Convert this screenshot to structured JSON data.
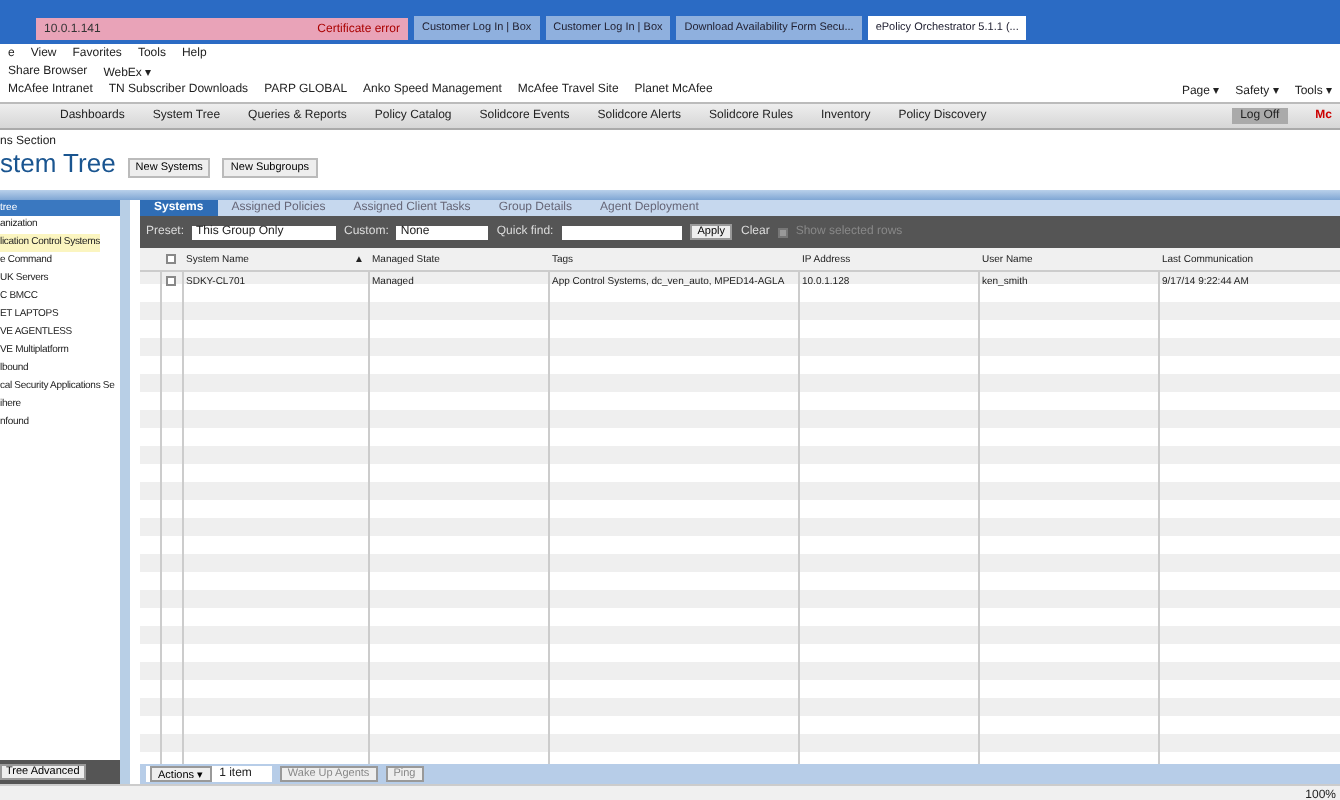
{
  "browser": {
    "address": "10.0.1.141",
    "certificate": "Certificate error",
    "tabs": [
      {
        "label": "Customer Log In | Box",
        "selected": false
      },
      {
        "label": "Customer Log In | Box",
        "selected": false
      },
      {
        "label": "Download Availability Form Secu...",
        "selected": false
      },
      {
        "label": "ePolicy Orchestrator 5.1.1 (...",
        "selected": true
      }
    ],
    "menu": [
      "e",
      "View",
      "Favorites",
      "Tools",
      "Help"
    ],
    "toolbar": [
      "Share Browser",
      "WebEx ▾"
    ],
    "favorites": [
      "McAfee Intranet",
      "TN Subscriber Downloads",
      "PARP GLOBAL",
      "Anko Speed Management",
      "McAfee Travel Site",
      "Planet McAfee"
    ],
    "commands": [
      "Page ▾",
      "Safety ▾",
      "Tools ▾"
    ]
  },
  "nav": {
    "items": [
      "Dashboards",
      "System Tree",
      "Queries & Reports",
      "Policy Catalog",
      "Solidcore Events",
      "Solidcore Alerts",
      "Solidcore Rules",
      "Inventory",
      "Policy Discovery"
    ],
    "log_off": "Log Off",
    "logo": "Mc"
  },
  "page": {
    "section": "ns Section",
    "title": "stem Tree",
    "buttons": [
      "New Systems",
      "New Subgroups"
    ]
  },
  "sidebar": {
    "header": "tree",
    "items": [
      {
        "label": "anization",
        "selected": false
      },
      {
        "label": "lication Control Systems",
        "selected": true
      },
      {
        "label": "e Command",
        "selected": false
      },
      {
        "label": "UK Servers",
        "selected": false
      },
      {
        "label": "C BMCC",
        "selected": false
      },
      {
        "label": "ET LAPTOPS",
        "selected": false
      },
      {
        "label": "VE AGENTLESS",
        "selected": false
      },
      {
        "label": "VE Multiplatform",
        "selected": false
      },
      {
        "label": "lbound",
        "selected": false
      },
      {
        "label": "cal Security Applications Se",
        "selected": false
      },
      {
        "label": "ihere",
        "selected": false
      },
      {
        "label": "nfound",
        "selected": false
      }
    ],
    "footer_button": "Tree Advanced"
  },
  "tabs": [
    {
      "label": "Systems",
      "selected": true
    },
    {
      "label": "Assigned Policies",
      "selected": false
    },
    {
      "label": "Assigned Client Tasks",
      "selected": false
    },
    {
      "label": "Group Details",
      "selected": false
    },
    {
      "label": "Agent Deployment",
      "selected": false
    }
  ],
  "filter": {
    "preset_label": "Preset:",
    "preset": "This Group Only",
    "custom_label": "Custom:",
    "custom": "None",
    "quick_find_label": "Quick find:",
    "apply": "Apply",
    "clear": "Clear",
    "show_selected": {
      "label": "Show selected rows",
      "checked": false,
      "disabled": true
    }
  },
  "table": {
    "select_all_checked": false,
    "sort_indicator": "▲",
    "columns": [
      "System Name",
      "Managed State",
      "Tags",
      "IP Address",
      "User Name",
      "Last Communication"
    ],
    "rows": [
      {
        "checked": false,
        "cells": [
          "SDKY-CL701",
          "Managed",
          "App Control Systems, dc_ven_auto, MPED14-AGLA",
          "10.0.1.128",
          "ken_smith",
          "9/17/14 9:22:44 AM"
        ]
      }
    ]
  },
  "footer": {
    "actions": "Actions ▾",
    "count": "1 item",
    "buttons": [
      "Wake Up Agents",
      "Ping"
    ]
  },
  "status": {
    "zoom": "100%"
  }
}
